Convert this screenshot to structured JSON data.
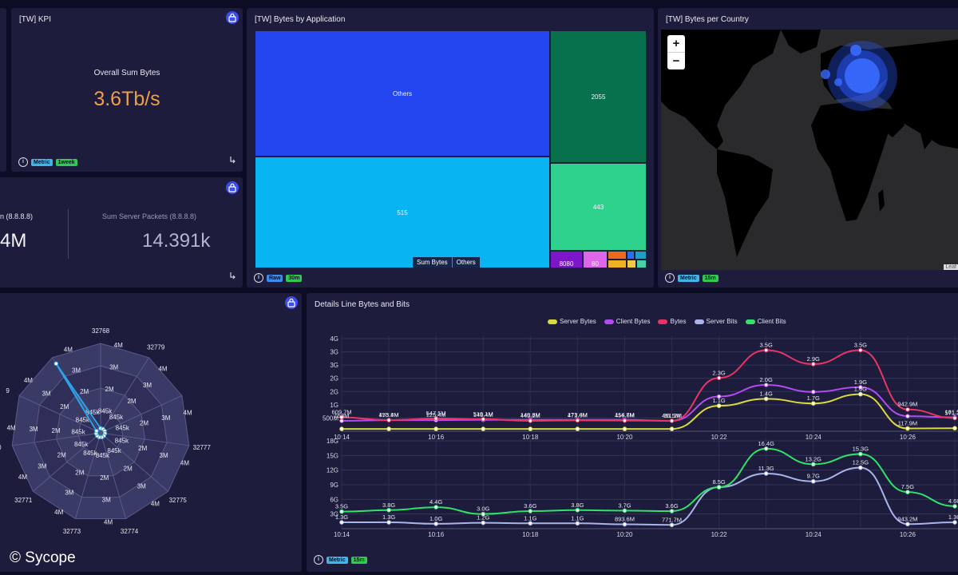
{
  "kpi": {
    "title": "[TW] KPI",
    "label": "Overall Sum Bytes",
    "value": "3.6Tb/s",
    "tags": [
      "Metric",
      "1week"
    ]
  },
  "packets": {
    "left_label": "n (8.8.8.8)",
    "left_value": "4M",
    "right_label": "Sum Server Packets (8.8.8.8)",
    "right_value": "14.391k"
  },
  "treemap": {
    "title": "[TW] Bytes by Application",
    "cells": [
      "Others",
      "2055",
      "515",
      "443",
      "8080",
      "80"
    ],
    "breadcrumb": [
      "Sum Bytes",
      "Others"
    ],
    "tags": [
      "Raw",
      "30m"
    ]
  },
  "map": {
    "title": "[TW] Bytes per Country",
    "zoom_in": "+",
    "zoom_out": "−",
    "tags": [
      "Metric",
      "15m"
    ],
    "attribution": "Leaf"
  },
  "radar": {
    "axes": [
      "32768",
      "32779",
      "32777",
      "32775",
      "32774",
      "32773",
      "32771",
      "0",
      "9"
    ],
    "ring_labels": [
      "845k",
      "2M",
      "3M",
      "4M"
    ]
  },
  "details": {
    "title": "Details Line Bytes and Bits",
    "tags": [
      "Metric",
      "15m"
    ],
    "legend": [
      {
        "name": "Server Bytes",
        "color": "#d9d93a"
      },
      {
        "name": "Client Bytes",
        "color": "#b24cf0"
      },
      {
        "name": "Bytes",
        "color": "#ea3464"
      },
      {
        "name": "Server Bits",
        "color": "#a9b4e8"
      },
      {
        "name": "Client Bits",
        "color": "#2fe36a"
      }
    ]
  },
  "chart_data": [
    {
      "type": "line",
      "title": "",
      "x": [
        "10:14",
        "10:15",
        "10:16",
        "10:17",
        "10:18",
        "10:19",
        "10:20",
        "10:21",
        "10:22",
        "10:23",
        "10:24",
        "10:25",
        "10:26",
        "10:27"
      ],
      "xticks": [
        "10:14",
        "10:16",
        "10:18",
        "10:20",
        "10:22",
        "10:24",
        "10:26"
      ],
      "yticks": [
        "500M",
        "1G",
        "2G",
        "2G",
        "3G",
        "3G",
        "4G"
      ],
      "ylim": [
        0,
        4
      ],
      "series": [
        {
          "name": "Server Bytes",
          "color": "#d9d93a",
          "values": [
            0.1,
            0.1,
            0.1,
            0.1,
            0.1,
            0.1,
            0.1,
            0.1,
            1.1,
            1.4,
            1.2,
            1.6,
            0.12,
            0.13
          ]
        },
        {
          "name": "Client Bytes",
          "color": "#b24cf0",
          "values": [
            0.45,
            0.48,
            0.48,
            0.49,
            0.49,
            0.49,
            0.49,
            0.45,
            1.5,
            2.0,
            1.7,
            1.9,
            0.65,
            0.6
          ]
        },
        {
          "name": "Bytes",
          "color": "#ea3464",
          "values": [
            0.6,
            0.48,
            0.55,
            0.52,
            0.45,
            0.47,
            0.46,
            0.45,
            2.3,
            3.5,
            2.9,
            3.5,
            0.94,
            0.57
          ]
        }
      ],
      "labels": [
        {
          "series": 2,
          "i": 0,
          "text": "609.7M"
        },
        {
          "series": 2,
          "i": 1,
          "text": "475.8M"
        },
        {
          "series": 2,
          "i": 2,
          "text": "547.5M"
        },
        {
          "series": 2,
          "i": 3,
          "text": "519.1M"
        },
        {
          "series": 2,
          "i": 4,
          "text": "445.2M"
        },
        {
          "series": 2,
          "i": 5,
          "text": "471.0M"
        },
        {
          "series": 2,
          "i": 6,
          "text": "456.6M"
        },
        {
          "series": 2,
          "i": 7,
          "text": "451.2M"
        },
        {
          "series": 2,
          "i": 8,
          "text": "2.3G"
        },
        {
          "series": 2,
          "i": 9,
          "text": "3.5G"
        },
        {
          "series": 2,
          "i": 10,
          "text": "2.9G"
        },
        {
          "series": 2,
          "i": 11,
          "text": "3.5G"
        },
        {
          "series": 2,
          "i": 12,
          "text": "942.9M"
        },
        {
          "series": 2,
          "i": 13,
          "text": "571.2M"
        },
        {
          "series": 1,
          "i": 0,
          "text": "158M"
        },
        {
          "series": 1,
          "i": 1,
          "text": "153.4M"
        },
        {
          "series": 1,
          "i": 2,
          "text": "125.4M"
        },
        {
          "series": 1,
          "i": 3,
          "text": "146.4M"
        },
        {
          "series": 1,
          "i": 4,
          "text": "140.8M"
        },
        {
          "series": 1,
          "i": 5,
          "text": "173.4M"
        },
        {
          "series": 1,
          "i": 6,
          "text": "114.7M"
        },
        {
          "series": 1,
          "i": 7,
          "text": "96.5M"
        },
        {
          "series": 1,
          "i": 9,
          "text": "2.0G"
        },
        {
          "series": 1,
          "i": 11,
          "text": "1.9G"
        },
        {
          "series": 1,
          "i": 13,
          "text": "161.5M"
        },
        {
          "series": 0,
          "i": 8,
          "text": "1.1G"
        },
        {
          "series": 0,
          "i": 9,
          "text": "1.4G"
        },
        {
          "series": 0,
          "i": 10,
          "text": "1.7G"
        },
        {
          "series": 0,
          "i": 11,
          "text": "1.6G"
        },
        {
          "series": 0,
          "i": 12,
          "text": "117.9M"
        }
      ]
    },
    {
      "type": "line",
      "title": "",
      "x": [
        "10:14",
        "10:15",
        "10:16",
        "10:17",
        "10:18",
        "10:19",
        "10:20",
        "10:21",
        "10:22",
        "10:23",
        "10:24",
        "10:25",
        "10:26",
        "10:27"
      ],
      "xticks": [
        "10:14",
        "10:16",
        "10:18",
        "10:20",
        "10:22",
        "10:24",
        "10:26"
      ],
      "yticks": [
        "3G",
        "6G",
        "9G",
        "12G",
        "15G",
        "18G"
      ],
      "ylim": [
        0,
        18
      ],
      "series": [
        {
          "name": "Server Bits",
          "color": "#a9b4e8",
          "values": [
            1.3,
            1.3,
            1.0,
            1.2,
            1.1,
            1.1,
            0.89,
            0.77,
            8.5,
            11.3,
            9.7,
            12.5,
            0.94,
            1.3
          ]
        },
        {
          "name": "Client Bits",
          "color": "#2fe36a",
          "values": [
            3.5,
            3.8,
            4.4,
            3.0,
            3.6,
            3.8,
            3.7,
            3.6,
            8.5,
            16.4,
            13.2,
            15.3,
            7.5,
            4.6
          ]
        }
      ],
      "labels": [
        {
          "series": 1,
          "i": 0,
          "text": "3.5G"
        },
        {
          "series": 1,
          "i": 1,
          "text": "3.8G"
        },
        {
          "series": 1,
          "i": 2,
          "text": "4.4G"
        },
        {
          "series": 1,
          "i": 3,
          "text": "3.0G"
        },
        {
          "series": 1,
          "i": 4,
          "text": "3.6G"
        },
        {
          "series": 1,
          "i": 5,
          "text": "3.8G"
        },
        {
          "series": 1,
          "i": 6,
          "text": "3.7G"
        },
        {
          "series": 1,
          "i": 7,
          "text": "3.6G"
        },
        {
          "series": 1,
          "i": 8,
          "text": "8.5G"
        },
        {
          "series": 1,
          "i": 9,
          "text": "16.4G"
        },
        {
          "series": 1,
          "i": 10,
          "text": "13.2G"
        },
        {
          "series": 1,
          "i": 11,
          "text": "15.3G"
        },
        {
          "series": 1,
          "i": 12,
          "text": "7.5G"
        },
        {
          "series": 1,
          "i": 13,
          "text": "4.6G"
        },
        {
          "series": 0,
          "i": 0,
          "text": "1.3G"
        },
        {
          "series": 0,
          "i": 1,
          "text": "1.3G"
        },
        {
          "series": 0,
          "i": 2,
          "text": "1.0G"
        },
        {
          "series": 0,
          "i": 3,
          "text": "1.2G"
        },
        {
          "series": 0,
          "i": 4,
          "text": "1.1G"
        },
        {
          "series": 0,
          "i": 5,
          "text": "1.1G"
        },
        {
          "series": 0,
          "i": 6,
          "text": "893.6M"
        },
        {
          "series": 0,
          "i": 7,
          "text": "771.7M"
        },
        {
          "series": 0,
          "i": 9,
          "text": "11.3G"
        },
        {
          "series": 0,
          "i": 10,
          "text": "9.7G"
        },
        {
          "series": 0,
          "i": 11,
          "text": "12.5G"
        },
        {
          "series": 0,
          "i": 12,
          "text": "943.2M"
        },
        {
          "series": 0,
          "i": 13,
          "text": "1.3G"
        }
      ]
    }
  ],
  "watermark": "© Sycope"
}
